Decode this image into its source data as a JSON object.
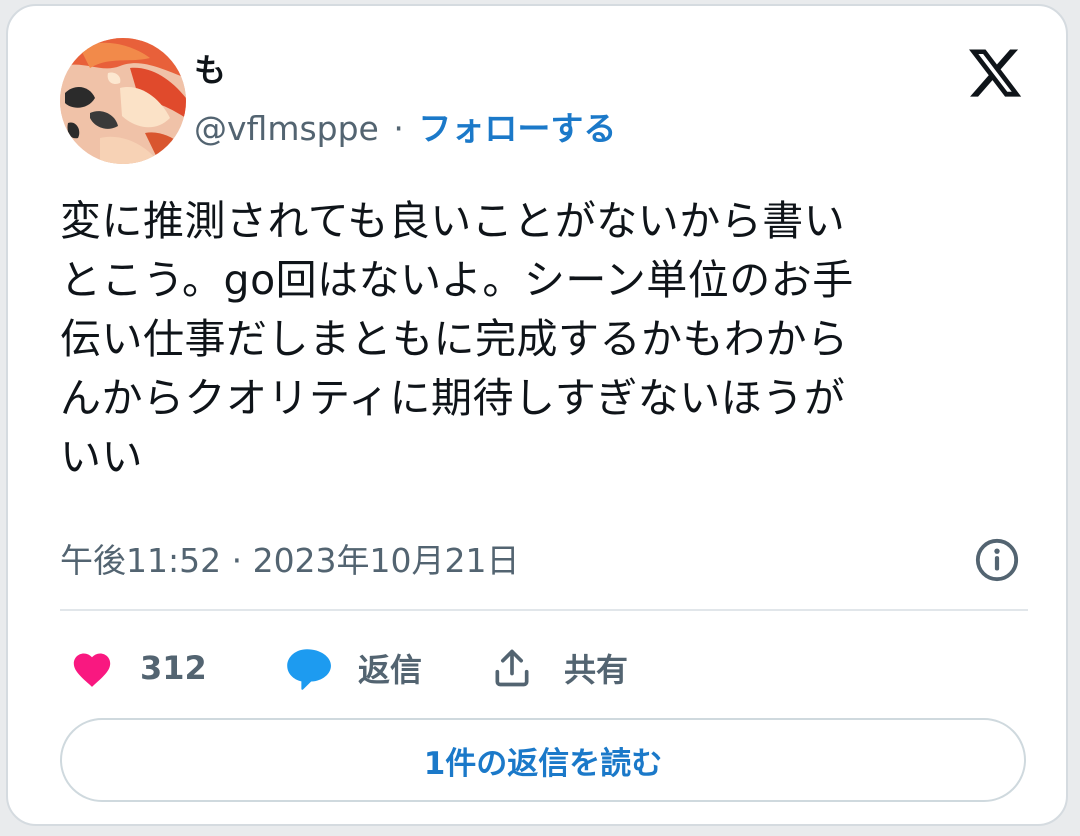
{
  "tweet": {
    "author": {
      "name": "も",
      "handle": "@vflmsppe",
      "separator": "·",
      "follow_label": "フォローする"
    },
    "logo_icon": "x-logo-icon",
    "text_lines": [
      "変に推測されても良いことがないから書い",
      "とこう。go回はないよ。シーン単位のお手",
      "伝い仕事だしまともに完成するかもわから",
      "んからクオリティに期待しすぎないほうが",
      "いい"
    ],
    "timestamp": "午後11:52 · 2023年10月21日",
    "info_icon": "info-icon",
    "actions": {
      "like_count": "312",
      "reply_label": "返信",
      "share_label": "共有"
    },
    "read_replies_label": "1件の返信を読む"
  },
  "colors": {
    "like": "#f91880",
    "reply": "#1d9bf0",
    "link": "#1b79c9",
    "secondary_text": "#536471"
  }
}
